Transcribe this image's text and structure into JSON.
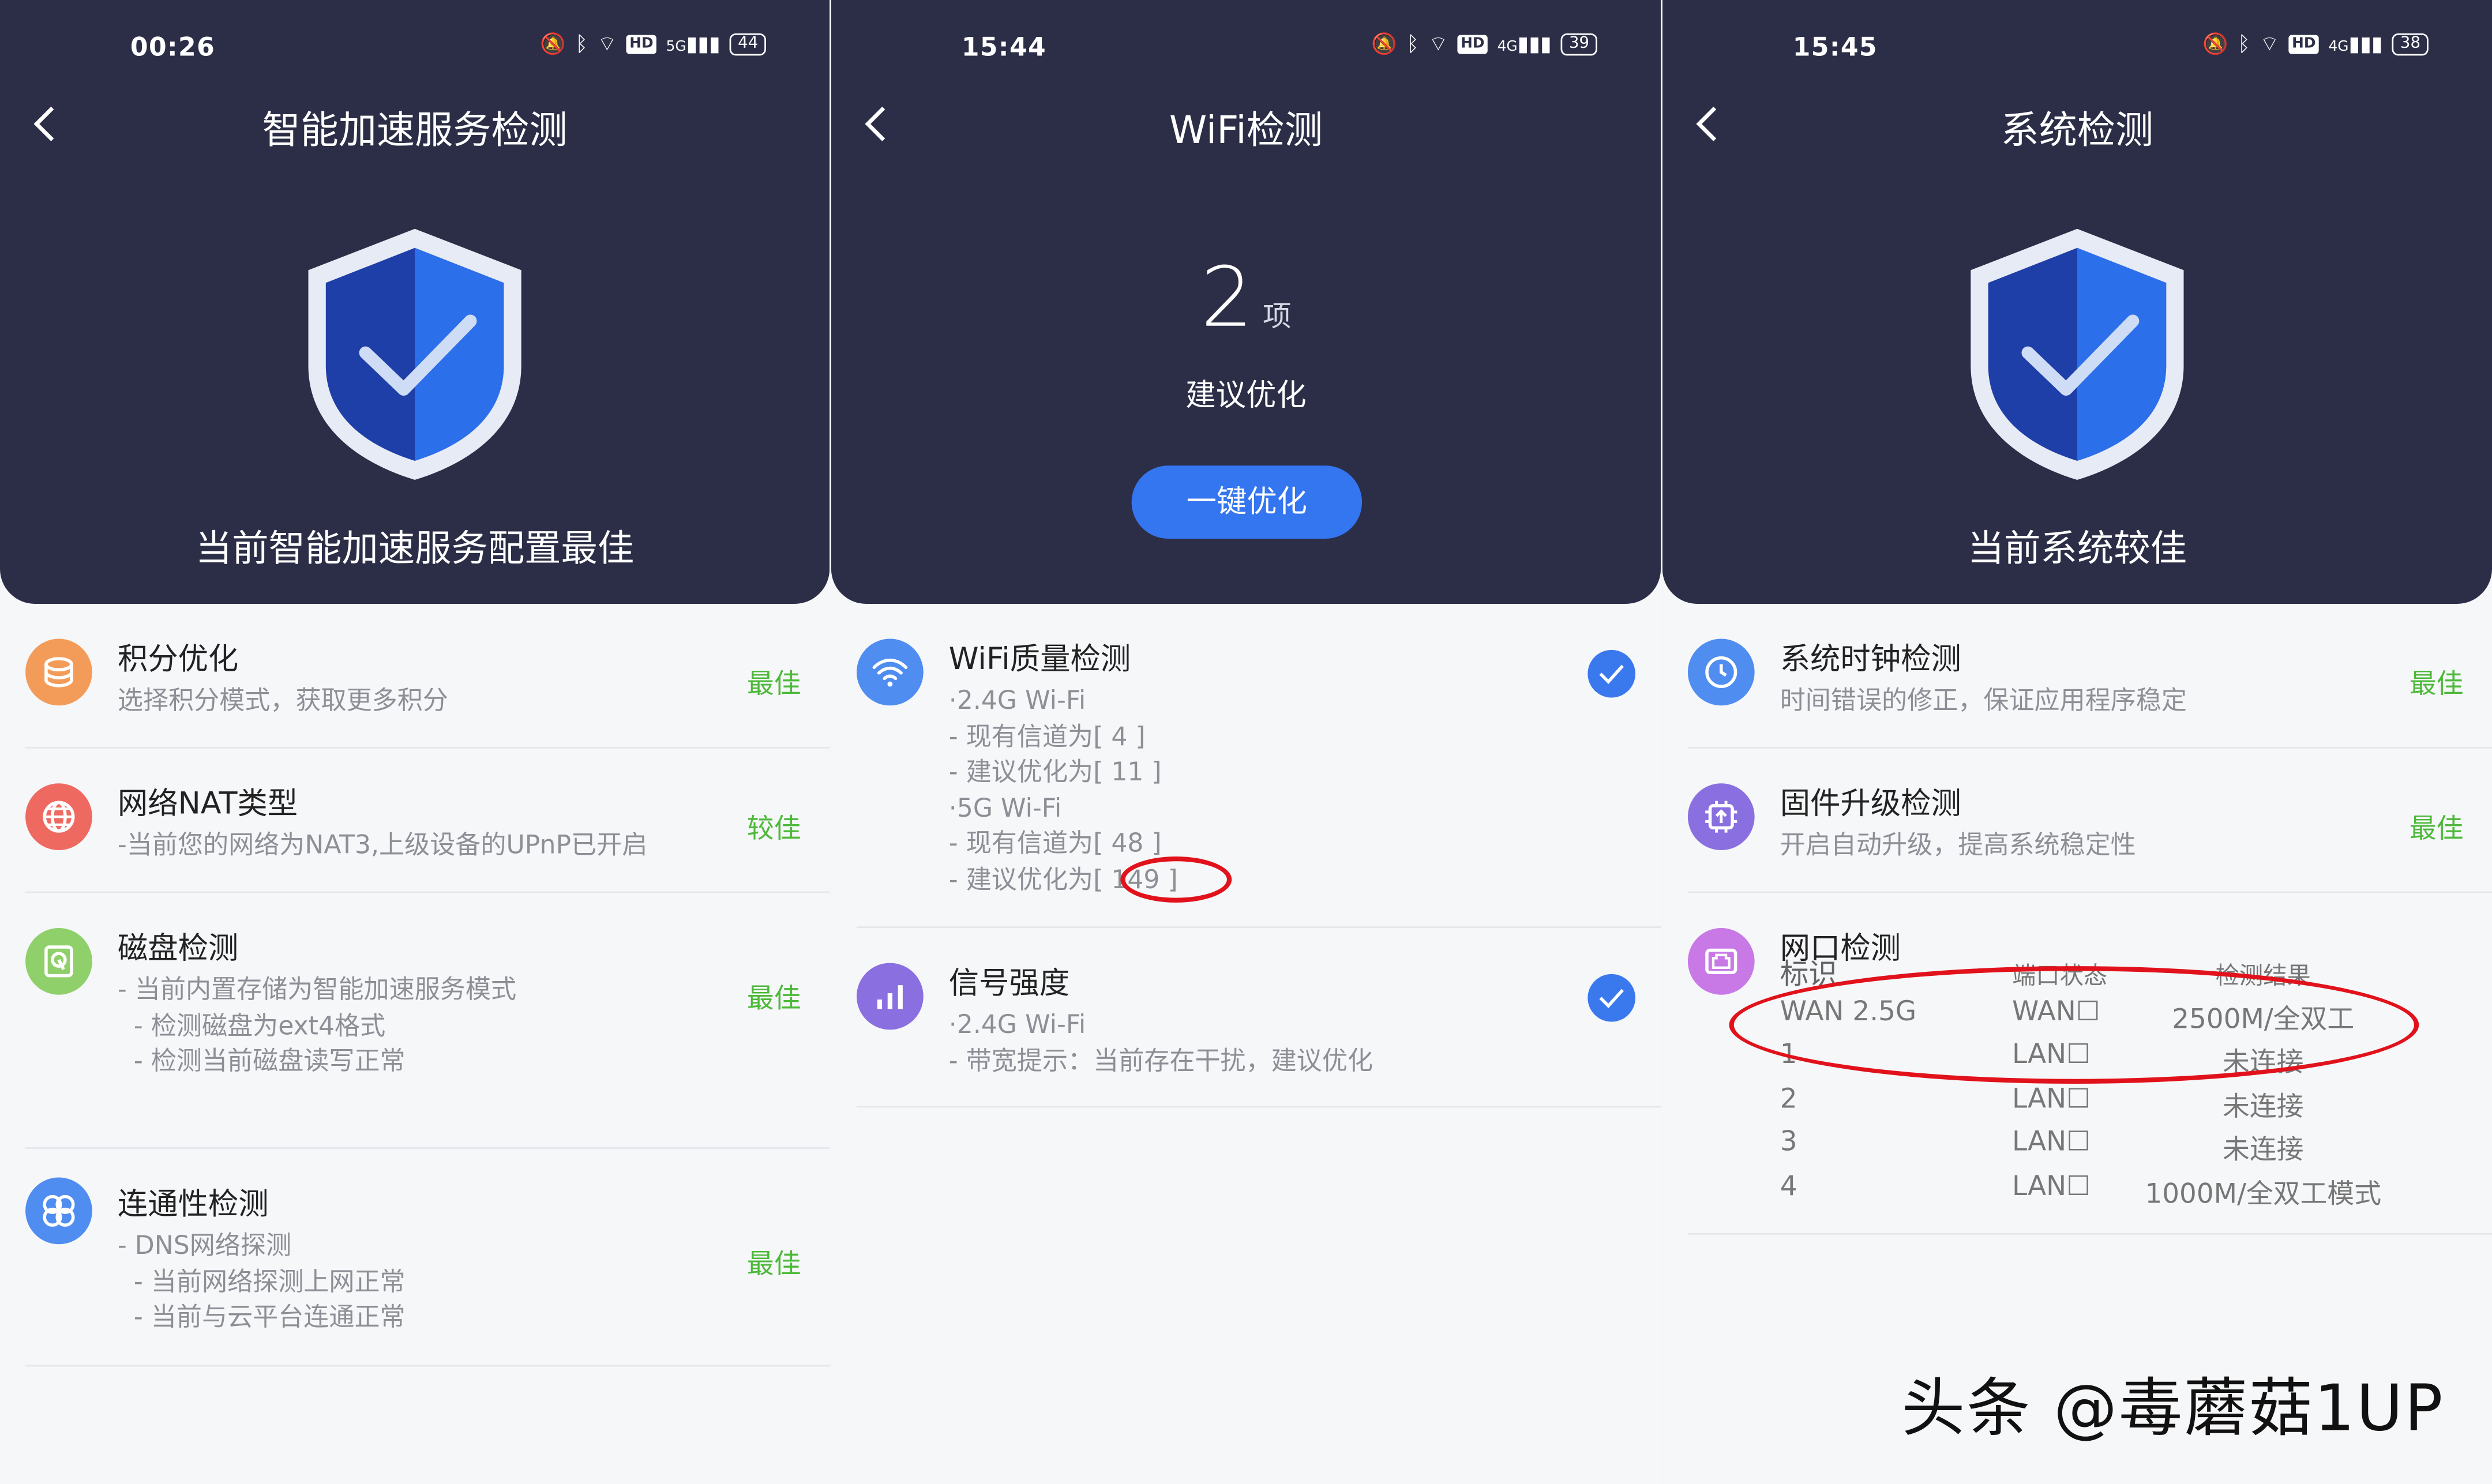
{
  "panels": [
    {
      "status": {
        "time": "00:26",
        "network": "5G",
        "battery": "44"
      },
      "title": "智能加速服务检测",
      "caption": "当前智能加速服务配置最佳",
      "items": [
        {
          "title": "积分优化",
          "lines": [
            "选择积分模式，获取更多积分"
          ],
          "badge": "最佳"
        },
        {
          "title": "网络NAT类型",
          "lines": [
            "-当前您的网络为NAT3,上级设备的UPnP已开启"
          ],
          "badge": "较佳"
        },
        {
          "title": "磁盘检测",
          "lines": [
            "- 当前内置存储为智能加速服务模式",
            "  - 检测磁盘为ext4格式",
            "  - 检测当前磁盘读写正常"
          ],
          "badge": "最佳"
        },
        {
          "title": "连通性检测",
          "lines": [
            "- DNS网络探测",
            "  - 当前网络探测上网正常",
            "  - 当前与云平台连通正常"
          ],
          "badge": "最佳"
        }
      ]
    },
    {
      "status": {
        "time": "15:44",
        "network": "4G",
        "battery": "39"
      },
      "title": "WiFi检测",
      "count": "2",
      "count_unit": "项",
      "suggest": "建议优化",
      "button": "一键优化",
      "items": [
        {
          "title": "WiFi质量检测",
          "lines": [
            "·2.4G  Wi-Fi",
            "- 现有信道为[ 4 ]",
            "- 建议优化为[ 11 ]",
            "·5G  Wi-Fi",
            "- 现有信道为[ 48 ]",
            "- 建议优化为[ 149 ]"
          ]
        },
        {
          "title": "信号强度",
          "lines": [
            "·2.4G  Wi-Fi",
            "- 带宽提示：当前存在干扰，建议优化"
          ]
        }
      ]
    },
    {
      "status": {
        "time": "15:45",
        "network": "4G",
        "battery": "38"
      },
      "title": "系统检测",
      "caption": "当前系统较佳",
      "items": [
        {
          "title": "系统时钟检测",
          "lines": [
            "时间错误的修正，保证应用程序稳定"
          ],
          "badge": "最佳"
        },
        {
          "title": "固件升级检测",
          "lines": [
            "开启自动升级，提高系统稳定性"
          ],
          "badge": "最佳"
        },
        {
          "title": "网口检测"
        }
      ],
      "port_table": {
        "headers": [
          "标识",
          "端口状态",
          "检测结果"
        ],
        "rows": [
          [
            "WAN 2.5G",
            "WAN☐",
            "2500M/全双工"
          ],
          [
            "1",
            "LAN☐",
            "未连接"
          ],
          [
            "2",
            "LAN☐",
            "未连接"
          ],
          [
            "3",
            "LAN☐",
            "未连接"
          ],
          [
            "4",
            "LAN☐",
            "1000M/全双工模式"
          ]
        ]
      }
    }
  ],
  "watermark": "头条 @毒蘑菇1UP",
  "colors": {
    "hero": "#2b2e46",
    "accent": "#3475f0",
    "good": "#4db93a",
    "annotation": "#e1121b"
  }
}
